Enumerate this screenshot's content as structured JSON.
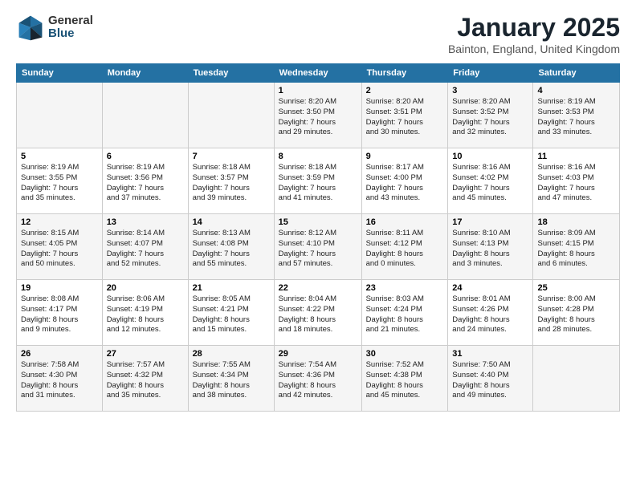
{
  "logo": {
    "general": "General",
    "blue": "Blue"
  },
  "title": "January 2025",
  "subtitle": "Bainton, England, United Kingdom",
  "headers": [
    "Sunday",
    "Monday",
    "Tuesday",
    "Wednesday",
    "Thursday",
    "Friday",
    "Saturday"
  ],
  "weeks": [
    [
      {
        "day": "",
        "info": ""
      },
      {
        "day": "",
        "info": ""
      },
      {
        "day": "",
        "info": ""
      },
      {
        "day": "1",
        "info": "Sunrise: 8:20 AM\nSunset: 3:50 PM\nDaylight: 7 hours\nand 29 minutes."
      },
      {
        "day": "2",
        "info": "Sunrise: 8:20 AM\nSunset: 3:51 PM\nDaylight: 7 hours\nand 30 minutes."
      },
      {
        "day": "3",
        "info": "Sunrise: 8:20 AM\nSunset: 3:52 PM\nDaylight: 7 hours\nand 32 minutes."
      },
      {
        "day": "4",
        "info": "Sunrise: 8:19 AM\nSunset: 3:53 PM\nDaylight: 7 hours\nand 33 minutes."
      }
    ],
    [
      {
        "day": "5",
        "info": "Sunrise: 8:19 AM\nSunset: 3:55 PM\nDaylight: 7 hours\nand 35 minutes."
      },
      {
        "day": "6",
        "info": "Sunrise: 8:19 AM\nSunset: 3:56 PM\nDaylight: 7 hours\nand 37 minutes."
      },
      {
        "day": "7",
        "info": "Sunrise: 8:18 AM\nSunset: 3:57 PM\nDaylight: 7 hours\nand 39 minutes."
      },
      {
        "day": "8",
        "info": "Sunrise: 8:18 AM\nSunset: 3:59 PM\nDaylight: 7 hours\nand 41 minutes."
      },
      {
        "day": "9",
        "info": "Sunrise: 8:17 AM\nSunset: 4:00 PM\nDaylight: 7 hours\nand 43 minutes."
      },
      {
        "day": "10",
        "info": "Sunrise: 8:16 AM\nSunset: 4:02 PM\nDaylight: 7 hours\nand 45 minutes."
      },
      {
        "day": "11",
        "info": "Sunrise: 8:16 AM\nSunset: 4:03 PM\nDaylight: 7 hours\nand 47 minutes."
      }
    ],
    [
      {
        "day": "12",
        "info": "Sunrise: 8:15 AM\nSunset: 4:05 PM\nDaylight: 7 hours\nand 50 minutes."
      },
      {
        "day": "13",
        "info": "Sunrise: 8:14 AM\nSunset: 4:07 PM\nDaylight: 7 hours\nand 52 minutes."
      },
      {
        "day": "14",
        "info": "Sunrise: 8:13 AM\nSunset: 4:08 PM\nDaylight: 7 hours\nand 55 minutes."
      },
      {
        "day": "15",
        "info": "Sunrise: 8:12 AM\nSunset: 4:10 PM\nDaylight: 7 hours\nand 57 minutes."
      },
      {
        "day": "16",
        "info": "Sunrise: 8:11 AM\nSunset: 4:12 PM\nDaylight: 8 hours\nand 0 minutes."
      },
      {
        "day": "17",
        "info": "Sunrise: 8:10 AM\nSunset: 4:13 PM\nDaylight: 8 hours\nand 3 minutes."
      },
      {
        "day": "18",
        "info": "Sunrise: 8:09 AM\nSunset: 4:15 PM\nDaylight: 8 hours\nand 6 minutes."
      }
    ],
    [
      {
        "day": "19",
        "info": "Sunrise: 8:08 AM\nSunset: 4:17 PM\nDaylight: 8 hours\nand 9 minutes."
      },
      {
        "day": "20",
        "info": "Sunrise: 8:06 AM\nSunset: 4:19 PM\nDaylight: 8 hours\nand 12 minutes."
      },
      {
        "day": "21",
        "info": "Sunrise: 8:05 AM\nSunset: 4:21 PM\nDaylight: 8 hours\nand 15 minutes."
      },
      {
        "day": "22",
        "info": "Sunrise: 8:04 AM\nSunset: 4:22 PM\nDaylight: 8 hours\nand 18 minutes."
      },
      {
        "day": "23",
        "info": "Sunrise: 8:03 AM\nSunset: 4:24 PM\nDaylight: 8 hours\nand 21 minutes."
      },
      {
        "day": "24",
        "info": "Sunrise: 8:01 AM\nSunset: 4:26 PM\nDaylight: 8 hours\nand 24 minutes."
      },
      {
        "day": "25",
        "info": "Sunrise: 8:00 AM\nSunset: 4:28 PM\nDaylight: 8 hours\nand 28 minutes."
      }
    ],
    [
      {
        "day": "26",
        "info": "Sunrise: 7:58 AM\nSunset: 4:30 PM\nDaylight: 8 hours\nand 31 minutes."
      },
      {
        "day": "27",
        "info": "Sunrise: 7:57 AM\nSunset: 4:32 PM\nDaylight: 8 hours\nand 35 minutes."
      },
      {
        "day": "28",
        "info": "Sunrise: 7:55 AM\nSunset: 4:34 PM\nDaylight: 8 hours\nand 38 minutes."
      },
      {
        "day": "29",
        "info": "Sunrise: 7:54 AM\nSunset: 4:36 PM\nDaylight: 8 hours\nand 42 minutes."
      },
      {
        "day": "30",
        "info": "Sunrise: 7:52 AM\nSunset: 4:38 PM\nDaylight: 8 hours\nand 45 minutes."
      },
      {
        "day": "31",
        "info": "Sunrise: 7:50 AM\nSunset: 4:40 PM\nDaylight: 8 hours\nand 49 minutes."
      },
      {
        "day": "",
        "info": ""
      }
    ]
  ]
}
